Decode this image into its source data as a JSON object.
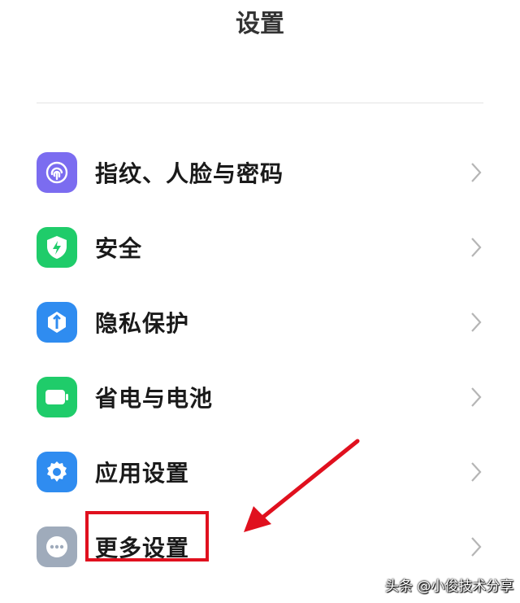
{
  "header": {
    "title": "设置"
  },
  "settings": {
    "items": [
      {
        "label": "指纹、人脸与密码",
        "icon": "fingerprint-icon",
        "color": "#7b6cf0"
      },
      {
        "label": "安全",
        "icon": "shield-icon",
        "color": "#1fcc6a"
      },
      {
        "label": "隐私保护",
        "icon": "privacy-icon",
        "color": "#2f8cf0"
      },
      {
        "label": "省电与电池",
        "icon": "battery-icon",
        "color": "#1fcc6a"
      },
      {
        "label": "应用设置",
        "icon": "gear-icon",
        "color": "#2f8cf0"
      },
      {
        "label": "更多设置",
        "icon": "more-icon",
        "color": "#9fabbb"
      }
    ]
  },
  "annotation": {
    "highlight_color": "#e0101e",
    "target": "更多设置"
  },
  "watermark": {
    "text": "头条 @小俊技术分享"
  }
}
